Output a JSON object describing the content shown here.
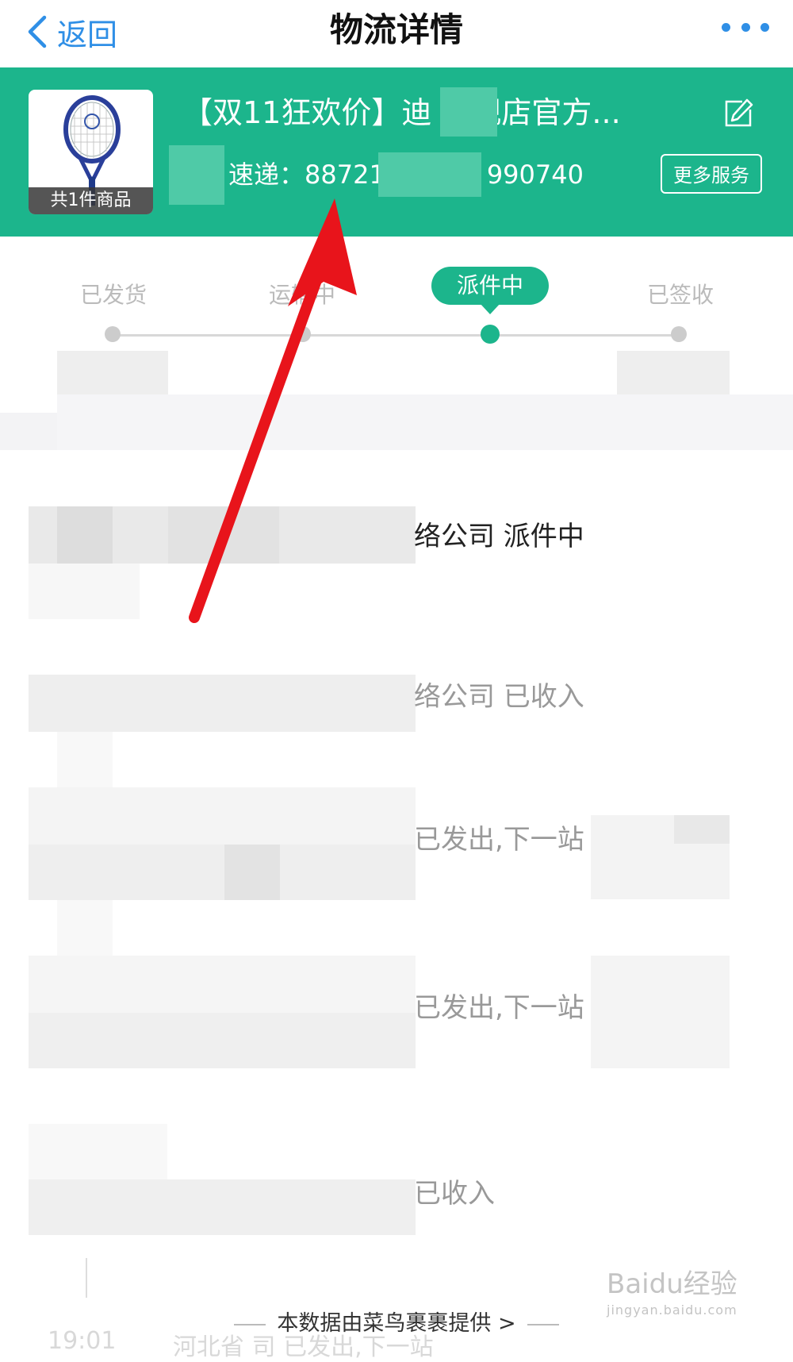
{
  "nav": {
    "back_label": "返回",
    "title": "物流详情"
  },
  "shipment": {
    "product_title": "【双11狂欢价】迪    旗舰店官方...",
    "item_count_label": "共1件商品",
    "carrier_label": "速递：",
    "tracking_number_prefix": "88721",
    "tracking_number_suffix": "990740",
    "more_services_label": "更多服务"
  },
  "progress": {
    "steps": [
      "已发货",
      "运输中",
      "派件中",
      "已签收"
    ],
    "current_step": 2
  },
  "timeline": {
    "events": [
      {
        "text": "络公司 派件中",
        "active": true
      },
      {
        "text": "络公司 已收入",
        "active": false
      },
      {
        "text": "已发出,下一站",
        "active": false
      },
      {
        "text": "已发出,下一站",
        "active": false
      },
      {
        "text": "已收入",
        "active": false
      }
    ]
  },
  "footer": {
    "data_source_label": "本数据由菜鸟裹裹提供 >",
    "partial_time": "19:01",
    "partial_event": "河北省            司 已发出,下一站"
  },
  "watermark": {
    "brand": "Baidu经验",
    "url": "jingyan.baidu.com"
  },
  "colors": {
    "accent_green": "#1cb58c",
    "link_blue": "#2f8fe6",
    "annotation_red": "#e8141b"
  }
}
